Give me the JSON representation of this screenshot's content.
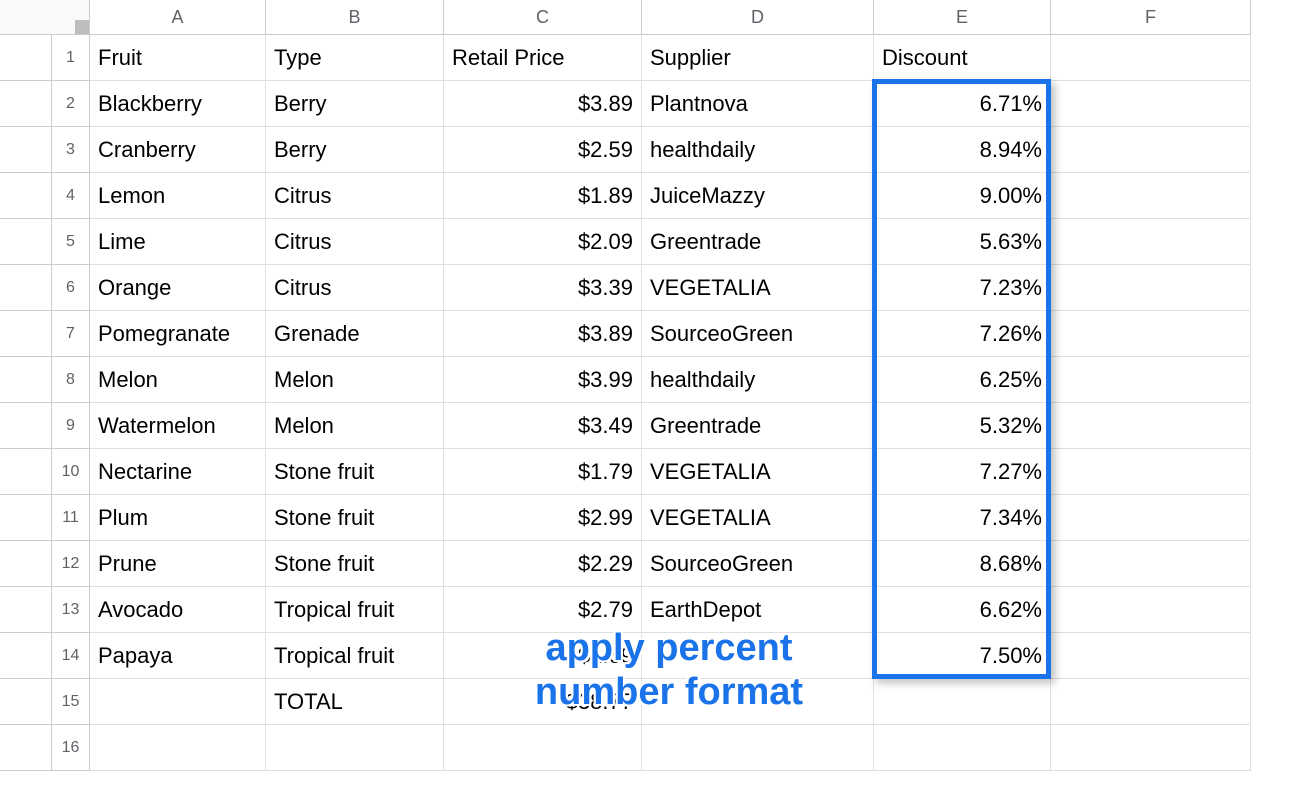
{
  "columns": [
    "A",
    "B",
    "C",
    "D",
    "E",
    "F"
  ],
  "rows": {
    "headers": [
      "Fruit",
      "Type",
      "Retail Price",
      "Supplier",
      "Discount",
      ""
    ],
    "data": [
      {
        "fruit": "Blackberry",
        "type": "Berry",
        "price": "$3.89",
        "supplier": "Plantnova",
        "discount": "6.71%"
      },
      {
        "fruit": "Cranberry",
        "type": "Berry",
        "price": "$2.59",
        "supplier": "healthdaily",
        "discount": "8.94%"
      },
      {
        "fruit": "Lemon",
        "type": "Citrus",
        "price": "$1.89",
        "supplier": "JuiceMazzy",
        "discount": "9.00%"
      },
      {
        "fruit": "Lime",
        "type": "Citrus",
        "price": "$2.09",
        "supplier": "Greentrade",
        "discount": "5.63%"
      },
      {
        "fruit": "Orange",
        "type": "Citrus",
        "price": "$3.39",
        "supplier": "VEGETALIA",
        "discount": "7.23%"
      },
      {
        "fruit": "Pomegranate",
        "type": "Grenade",
        "price": "$3.89",
        "supplier": "SourceoGreen",
        "discount": "7.26%"
      },
      {
        "fruit": "Melon",
        "type": "Melon",
        "price": "$3.99",
        "supplier": "healthdaily",
        "discount": "6.25%"
      },
      {
        "fruit": "Watermelon",
        "type": "Melon",
        "price": "$3.49",
        "supplier": "Greentrade",
        "discount": "5.32%"
      },
      {
        "fruit": "Nectarine",
        "type": "Stone fruit",
        "price": "$1.79",
        "supplier": "VEGETALIA",
        "discount": "7.27%"
      },
      {
        "fruit": "Plum",
        "type": "Stone fruit",
        "price": "$2.99",
        "supplier": "VEGETALIA",
        "discount": "7.34%"
      },
      {
        "fruit": "Prune",
        "type": "Stone fruit",
        "price": "$2.29",
        "supplier": "SourceoGreen",
        "discount": "8.68%"
      },
      {
        "fruit": "Avocado",
        "type": "Tropical fruit",
        "price": "$2.79",
        "supplier": "EarthDepot",
        "discount": "6.62%"
      },
      {
        "fruit": "Papaya",
        "type": "Tropical fruit",
        "price": "$1.69",
        "supplier": "",
        "discount": "7.50%"
      }
    ],
    "total": {
      "label": "TOTAL",
      "value": "$38.77"
    }
  },
  "rowNumbers": [
    "1",
    "2",
    "3",
    "4",
    "5",
    "6",
    "7",
    "8",
    "9",
    "10",
    "11",
    "12",
    "13",
    "14",
    "15",
    "16"
  ],
  "annotation": {
    "line1": "apply percent",
    "line2": "number format"
  },
  "selection": {
    "range": "E2:E14"
  }
}
